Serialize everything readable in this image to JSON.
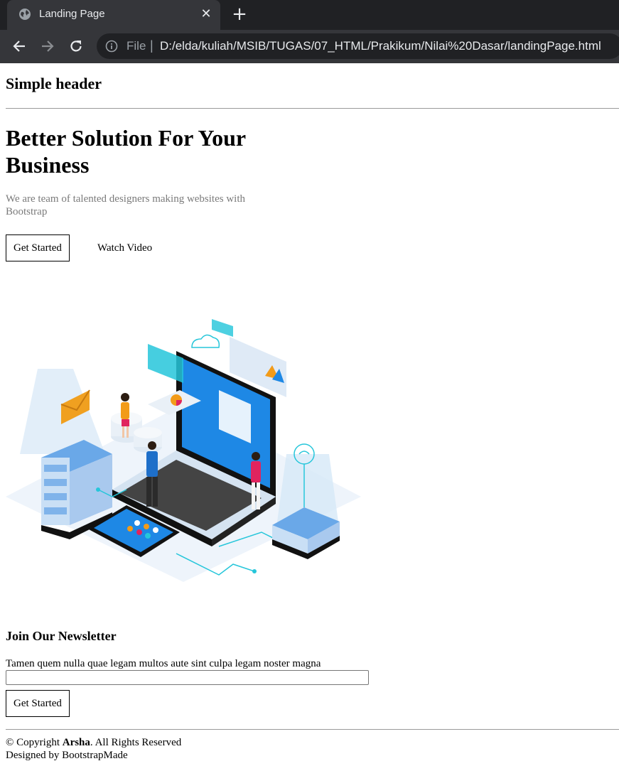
{
  "browser": {
    "tab_title": "Landing Page",
    "close_glyph": "✕",
    "new_tab_glyph": "+",
    "url_scheme": "File",
    "url_separator": "|",
    "url": "D:/elda/kuliah/MSIB/TUGAS/07_HTML/Prakikum/Nilai%20Dasar/landingPage.html"
  },
  "header": {
    "title": "Simple header"
  },
  "hero": {
    "title": "Better Solution For Your Business",
    "subtitle": "We are team of talented designers making websites with Bootstrap",
    "cta_label": "Get Started",
    "video_label": "Watch Video"
  },
  "newsletter": {
    "title": "Join Our Newsletter",
    "text": "Tamen quem nulla quae legam multos aute sint culpa legam noster magna",
    "input_value": "",
    "submit_label": "Get Started"
  },
  "footer": {
    "copyright_prefix": "© Copyright ",
    "brand": "Arsha",
    "copyright_suffix": ". All Rights Reserved",
    "designed_by": "Designed by BootstrapMade"
  },
  "icons": {
    "globe": "globe-icon",
    "back": "back-arrow-icon",
    "forward": "forward-arrow-icon",
    "reload": "reload-icon",
    "info": "info-icon"
  },
  "colors": {
    "chrome_dark": "#202124",
    "chrome_tab": "#35363a",
    "muted_text": "#7a7a7a",
    "illustration_blue": "#1e88e5",
    "illustration_cyan": "#26c6da"
  }
}
